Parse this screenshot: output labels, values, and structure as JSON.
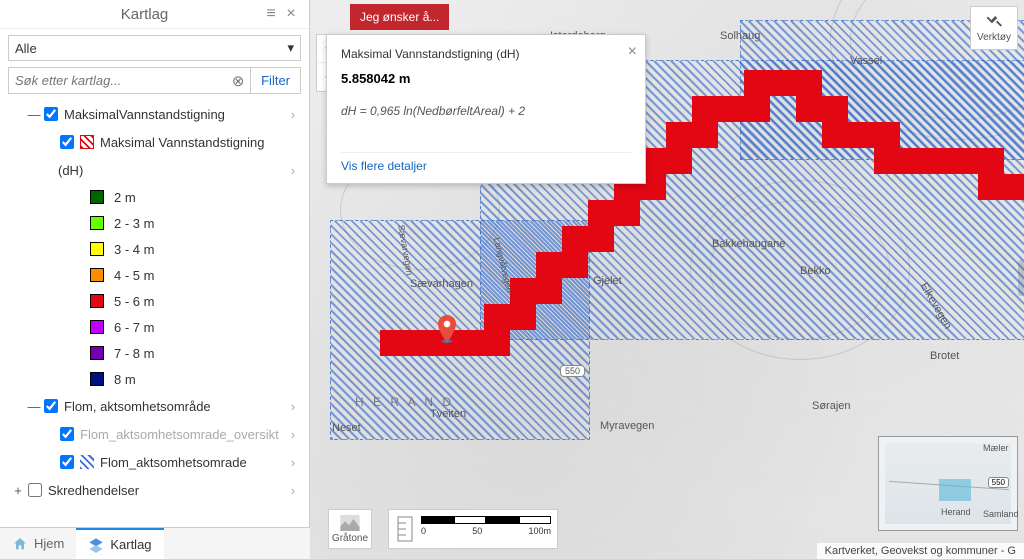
{
  "sidebar": {
    "title": "Kartlag",
    "select_value": "Alle",
    "search_placeholder": "Søk etter kartlag...",
    "filter_label": "Filter",
    "layers": {
      "maks_group": "MaksimalVannstandstigning",
      "maks_item": "Maksimal Vannstandstigning",
      "maks_suffix": "(dH)",
      "flom_group": "Flom, aktsomhetsområde",
      "flom_oversikt": "Flom_aktsomhetsomrade_oversikt",
      "flom_omrade": "Flom_aktsomhetsomrade",
      "skred": "Skredhendelser"
    },
    "legend": [
      {
        "label": "2 m",
        "color": "#006400"
      },
      {
        "label": "2 - 3 m",
        "color": "#66ff00"
      },
      {
        "label": "3 - 4 m",
        "color": "#ffff00"
      },
      {
        "label": "4 - 5 m",
        "color": "#ff8c00"
      },
      {
        "label": "5 - 6 m",
        "color": "#e30613"
      },
      {
        "label": "6 - 7 m",
        "color": "#c000ff"
      },
      {
        "label": "7 - 8 m",
        "color": "#7000b0"
      },
      {
        "label": "8 m",
        "color": "#001080"
      }
    ]
  },
  "tabs": {
    "hjem": "Hjem",
    "kartlag": "Kartlag"
  },
  "map": {
    "wish": "Jeg ønsker å...",
    "tools": "Verktøy",
    "gratone": "Gråtone",
    "attribution": "Kartverket, Geovekst og kommuner - G",
    "scale": {
      "s0": "0",
      "s1": "50",
      "s2": "100m"
    },
    "places": {
      "solhaug": "Solhaug",
      "vassel": "Vassel",
      "isterdeberg": "Isterdeberg",
      "bakkehaugane": "Bakkehaugane",
      "gjelet": "Gjelet",
      "bekko": "Bekko",
      "saevarhagen": "Sævarhagen",
      "tveiten": "Tveiten",
      "myravegen": "Myravegen",
      "neset": "Neset",
      "herand": "H E R A N D",
      "brotet": "Brotet",
      "sorajen": "Sørajen",
      "elkevegen": "Elkevegen",
      "langv": "Langvåtvegen",
      "saev": "Sævarvegen",
      "r550": "550"
    },
    "mini": {
      "maeler": "Mæler",
      "herand": "Herand",
      "samland": "Samland",
      "r550": "550"
    }
  },
  "popup": {
    "title": "Maksimal Vannstandstigning (dH)",
    "value": "5.858042 m",
    "formula": "dH = 0,965 ln(NedbørfeltAreal) + 2",
    "details": "Vis flere detaljer"
  }
}
